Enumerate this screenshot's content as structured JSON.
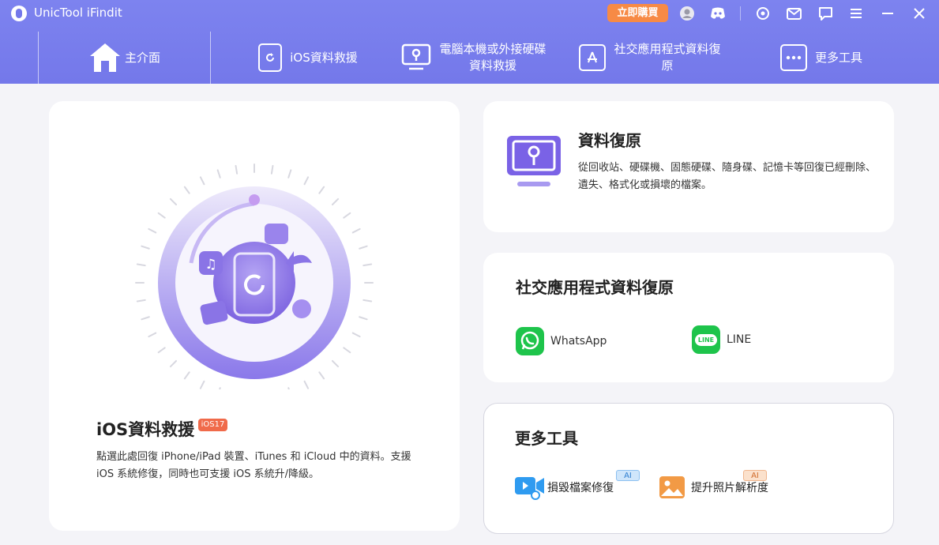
{
  "titlebar": {
    "app_title": "UnicTool iFindit",
    "buy_label": "立即購買"
  },
  "nav": {
    "items": [
      {
        "label": "主介面",
        "icon": "home-icon"
      },
      {
        "label": "iOS資料救援",
        "icon": "ios-refresh-icon"
      },
      {
        "label": "電腦本機或外接硬碟\n資料救援",
        "icon": "monitor-icon"
      },
      {
        "label": "社交應用程式資料復\n原",
        "icon": "app-store-icon"
      },
      {
        "label": "更多工具",
        "icon": "more-dots-icon"
      }
    ]
  },
  "ios_card": {
    "title": "iOS資料救援",
    "badge": "iOS17",
    "description": "點選此處回復 iPhone/iPad 裝置、iTunes 和 iCloud 中的資料。支援 iOS 系統修復，同時也可支援 iOS 系統升/降級。"
  },
  "recovery_card": {
    "title": "資料復原",
    "description": "從回收站、硬碟機、固態硬碟、隨身碟、記憶卡等回復已經刪除、遺失、格式化或損壞的檔案。"
  },
  "social_card": {
    "title": "社交應用程式資料復原",
    "apps": [
      {
        "label": "WhatsApp",
        "icon": "whatsapp-icon"
      },
      {
        "label": "LINE",
        "icon": "line-icon",
        "logo_text": "LINE"
      }
    ]
  },
  "tools_card": {
    "title": "更多工具",
    "tools": [
      {
        "label": "損毀檔案修復",
        "tag": "AI",
        "icon": "video-repair-icon"
      },
      {
        "label": "提升照片解析度",
        "tag": "AI",
        "icon": "photo-enhance-icon"
      }
    ]
  },
  "colors": {
    "header": "#7478ea",
    "accent": "#7478ea",
    "buy": "#f78a45",
    "green": "#1ec44b"
  }
}
